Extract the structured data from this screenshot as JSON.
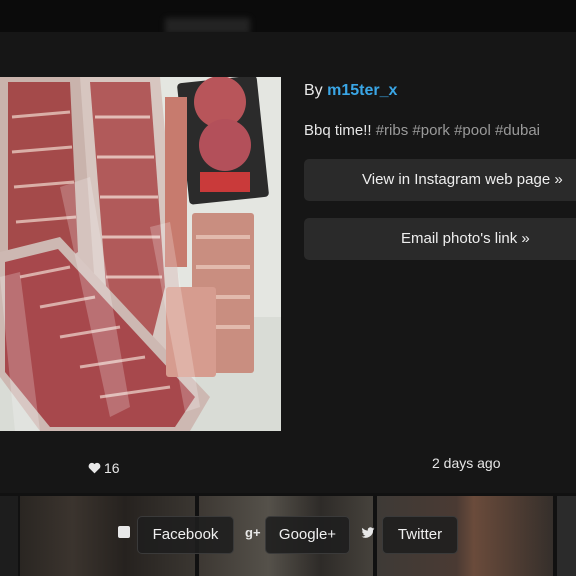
{
  "post": {
    "by_label": "By",
    "username": "m15ter_x",
    "caption_text": "Bbq time!!",
    "hashtags": [
      "#ribs",
      "#pork",
      "#pool",
      "#dubai"
    ],
    "likes": "16",
    "time_ago": "2 days ago"
  },
  "actions": {
    "view_instagram": "View in Instagram web page »",
    "email_link": "Email photo's link »"
  },
  "share": {
    "facebook": {
      "icon": "f",
      "label": "Facebook"
    },
    "google": {
      "icon": "g+",
      "label": "Google+"
    },
    "twitter": {
      "icon": "twitter-bird",
      "label": "Twitter"
    }
  },
  "colors": {
    "username": "#3aa6e6",
    "modal_bg": "#161616",
    "button_bg": "#2a2a2a"
  }
}
